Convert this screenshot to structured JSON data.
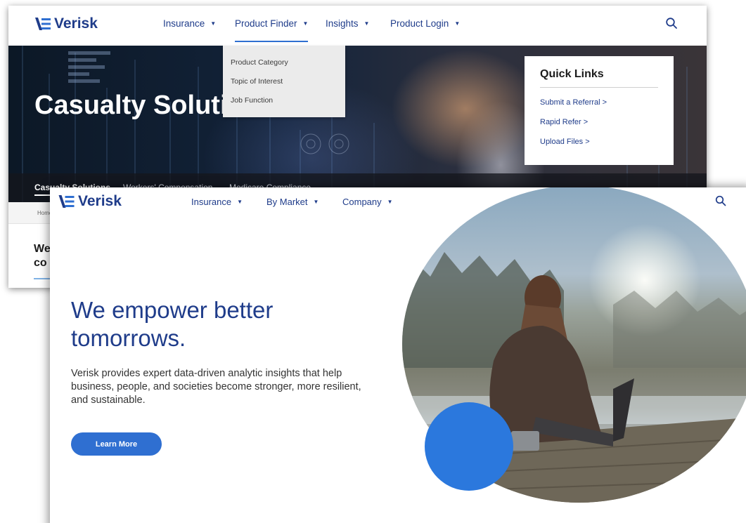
{
  "colors": {
    "brand_navy": "#1f3c8a",
    "accent_blue": "#2f6fd1",
    "dot_blue": "#2b78dd"
  },
  "back_window": {
    "logo_text": "Verisk",
    "nav": [
      {
        "label": "Insurance",
        "has_caret": true
      },
      {
        "label": "Product Finder",
        "has_caret": true,
        "active": true
      },
      {
        "label": "Insights",
        "has_caret": true
      },
      {
        "label": "Product Login",
        "has_caret": true
      }
    ],
    "search_icon": "search-icon",
    "dropdown": [
      "Product Category",
      "Topic of Interest",
      "Job Function"
    ],
    "hero_title": "Casualty Solutic",
    "quick_links": {
      "title": "Quick Links",
      "links": [
        "Submit a Referral >",
        "Rapid Refer >",
        "Upload Files >"
      ]
    },
    "tabs": [
      "Casualty Solutions",
      "Workers' Compensation",
      "Medicare Compliance"
    ],
    "breadcrumb_home": "Home",
    "section_heading_fragment": "We co"
  },
  "front_window": {
    "logo_text": "Verisk",
    "nav": [
      {
        "label": "Insurance",
        "has_caret": true
      },
      {
        "label": "By Market",
        "has_caret": true
      },
      {
        "label": "Company",
        "has_caret": true
      }
    ],
    "search_icon": "search-icon",
    "headline": "We empower better tomorrows.",
    "subcopy": "Verisk provides expert data-driven analytic insights that help business, people, and societies become stronger, more resilient, and sustainable.",
    "cta_label": "Learn More"
  }
}
